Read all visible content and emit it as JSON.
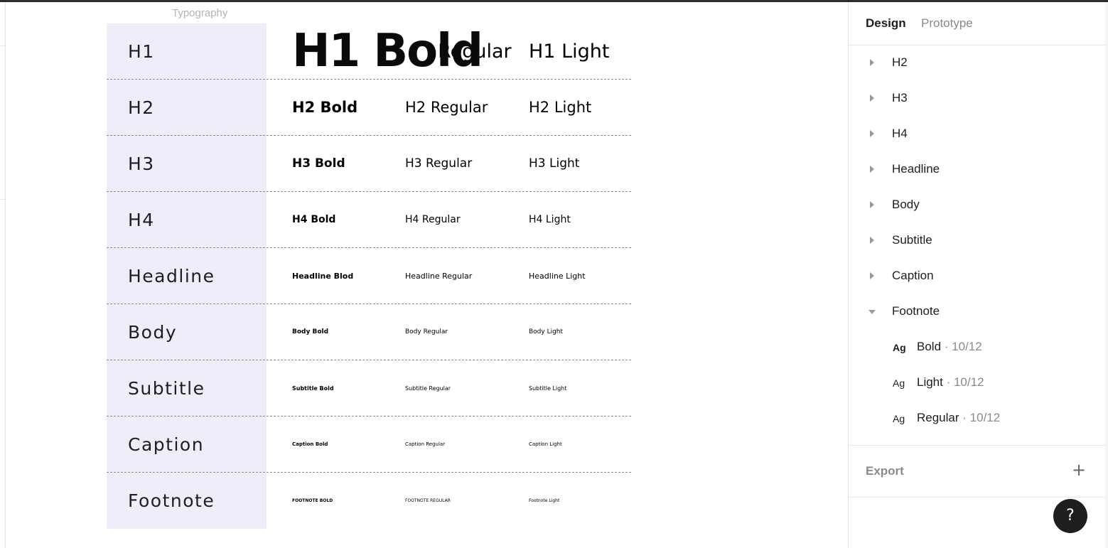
{
  "canvas": {
    "frame_label": "Typography",
    "rows": [
      {
        "name": "H1",
        "bold": "H1 Bold",
        "regular": "H1 Regular",
        "light": "H1 Light"
      },
      {
        "name": "H2",
        "bold": "H2 Bold",
        "regular": "H2 Regular",
        "light": "H2 Light"
      },
      {
        "name": "H3",
        "bold": "H3 Bold",
        "regular": "H3 Regular",
        "light": "H3 Light"
      },
      {
        "name": "H4",
        "bold": "H4 Bold",
        "regular": "H4 Regular",
        "light": "H4 Light"
      },
      {
        "name": "Headline",
        "bold": "Headline Blod",
        "regular": "Headline Regular",
        "light": "Headline Light"
      },
      {
        "name": "Body",
        "bold": "Body Bold",
        "regular": "Body Regular",
        "light": "Body Light"
      },
      {
        "name": "Subtitle",
        "bold": "Subtitle Bold",
        "regular": "Subtitle Regular",
        "light": "Subtitle Light"
      },
      {
        "name": "Caption",
        "bold": "Caption Bold",
        "regular": "Caption Regular",
        "light": "Caption Light"
      },
      {
        "name": "Footnote",
        "bold": "FOOTNOTE BOLD",
        "regular": "FOOTNOTE REGULAR",
        "light": "Footnote Light"
      }
    ],
    "h1_regular_visible": "Regular"
  },
  "panel": {
    "tabs": {
      "design": "Design",
      "prototype": "Prototype"
    },
    "styles": [
      "H2",
      "H3",
      "H4",
      "Headline",
      "Body",
      "Subtitle",
      "Caption",
      "Footnote"
    ],
    "footnote_styles": [
      {
        "ag": "Ag",
        "name": "Bold",
        "meta": " · 10/12"
      },
      {
        "ag": "Ag",
        "name": "Light",
        "meta": " · 10/12"
      },
      {
        "ag": "Ag",
        "name": "Regular",
        "meta": " · 10/12"
      }
    ],
    "export_label": "Export",
    "export_add": "+"
  },
  "help_label": "?",
  "icons": {
    "expand": "chevron-right-icon",
    "collapse": "chevron-down-icon",
    "add": "plus-icon",
    "help": "help-icon"
  }
}
